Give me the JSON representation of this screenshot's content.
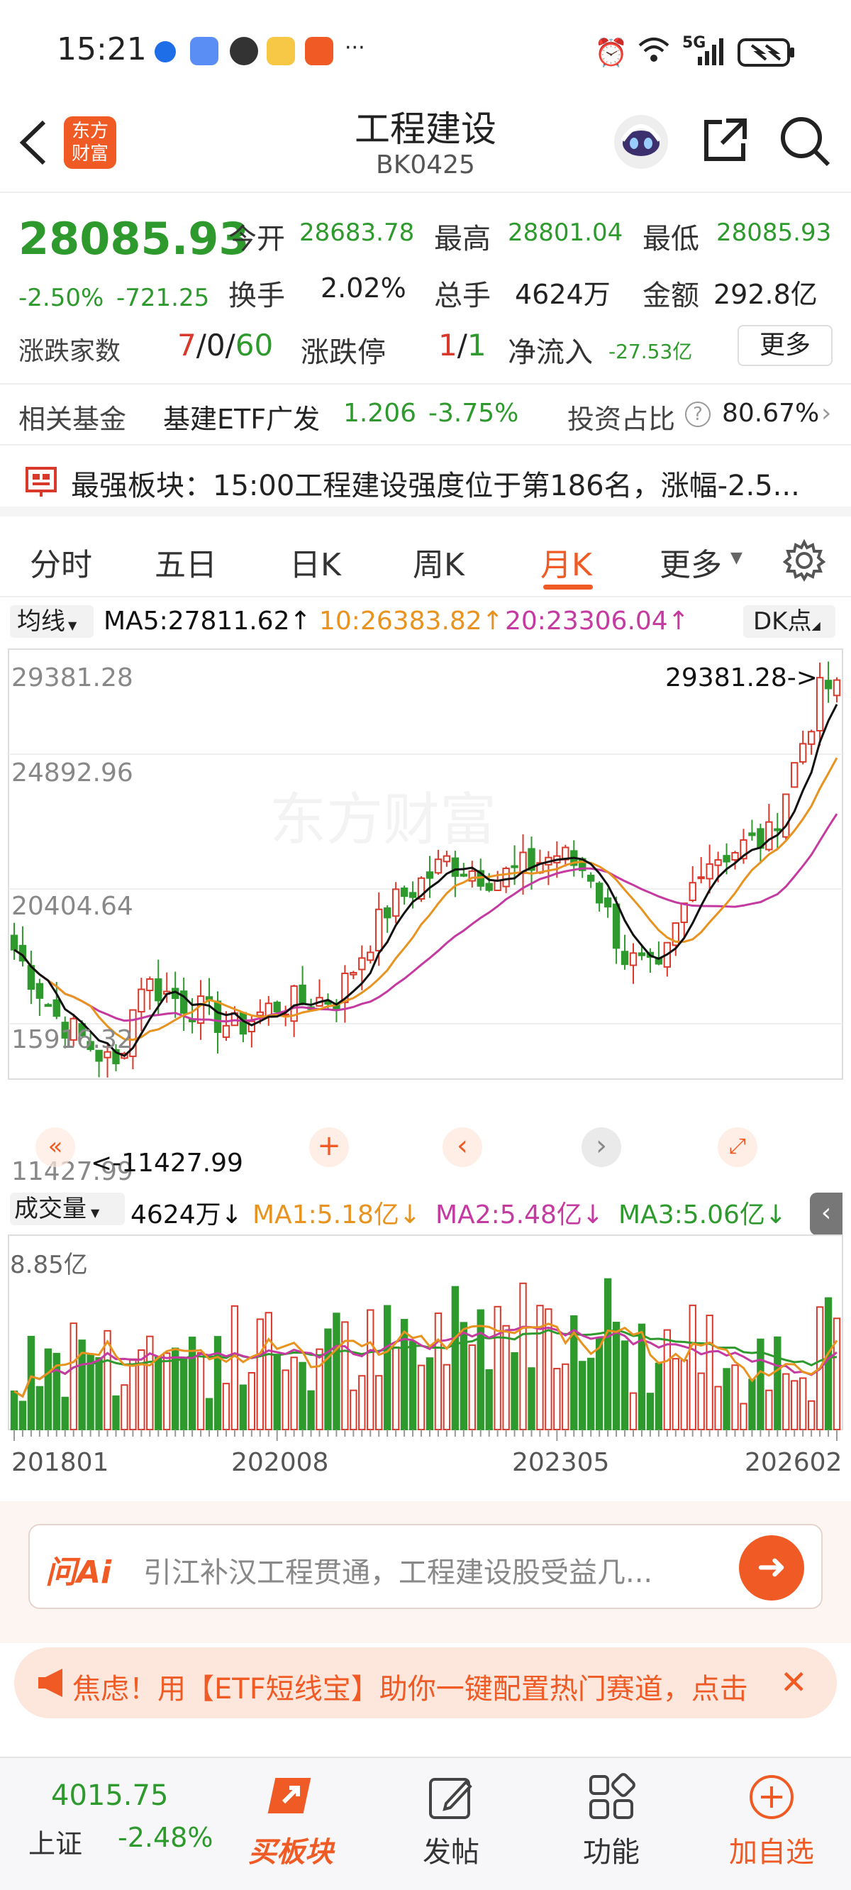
{
  "status_bar": {
    "time": "15:21",
    "ellipsis": "···",
    "network": "5G"
  },
  "header": {
    "title": "工程建设",
    "code": "BK0425",
    "logo_line1": "东方",
    "logo_line2": "财富"
  },
  "quote": {
    "price": "28085.93",
    "change_pct": "-2.50%",
    "change_abs": "-721.25",
    "open_label": "今开",
    "open": "28683.78",
    "high_label": "最高",
    "high": "28801.04",
    "low_label": "最低",
    "low": "28085.93",
    "turnover_label": "换手",
    "turnover": "2.02%",
    "volume_label": "总手",
    "volume": "4624万",
    "amount_label": "金额",
    "amount": "292.8亿",
    "breadth_label": "涨跌家数",
    "breadth_up": "7",
    "breadth_flat": "0",
    "breadth_down": "60",
    "limit_label": "涨跌停",
    "limit_up": "1",
    "limit_down": "1",
    "netflow_label": "净流入",
    "netflow": "-27.53亿",
    "more_label": "更多"
  },
  "fund": {
    "label": "相关基金",
    "name": "基建ETF广发",
    "price": "1.206",
    "pct": "-3.75%",
    "ratio_label": "投资占比",
    "ratio": "80.67%"
  },
  "strongest": {
    "text": "最强板块：15:00工程建设强度位于第186名，涨幅-2.5..."
  },
  "tabs": [
    {
      "label": "分时"
    },
    {
      "label": "五日"
    },
    {
      "label": "日K"
    },
    {
      "label": "周K"
    },
    {
      "label": "月K"
    },
    {
      "label": "更多"
    }
  ],
  "chart_header": {
    "ma_selector": "均线",
    "ma5": "MA5:27811.62↑",
    "ma10": "10:26383.82↑",
    "ma20": "20:23306.04↑",
    "dk_button": "DK点"
  },
  "price_axis": {
    "max_label": "29381.28",
    "l2": "24892.96",
    "l3": "20404.64",
    "l4": "15916.32",
    "min_label": "11427.99",
    "max_annot": "29381.28->",
    "min_annot": "<-11427.99"
  },
  "volume_header": {
    "selector": "成交量",
    "vol": "4624万↓",
    "ma1": "MA1:5.18亿↓",
    "ma2": "MA2:5.48亿↓",
    "ma3": "MA3:5.06亿↓",
    "max_label": "8.85亿"
  },
  "date_axis": {
    "d1": "201801",
    "d2": "202008",
    "d3": "202305",
    "d4": "202602"
  },
  "ai_box": {
    "brand": "问Ai",
    "text": "引江补汉工程贯通，工程建设股受益几..."
  },
  "banner": {
    "text": "焦虑！用【ETF短线宝】助你一键配置热门赛道，点击"
  },
  "bottom_nav": {
    "index_value": "4015.75",
    "index_name": "上证",
    "index_pct": "-2.48%",
    "buy_label": "买板块",
    "post_label": "发帖",
    "func_label": "功能",
    "add_label": "加自选"
  },
  "colors": {
    "up": "#d9392b",
    "down": "#2e9a2e",
    "ma5": "#111111",
    "ma10": "#e89320",
    "ma20": "#c43aa0",
    "accent": "#f05a24"
  },
  "chart_data": {
    "type": "candlestick",
    "period": "monthly",
    "y_range": [
      11427.99,
      29381.28
    ],
    "series_trend": [
      {
        "date": "2018-01",
        "close": 16800
      },
      {
        "date": "2018-06",
        "close": 14000
      },
      {
        "date": "2019-01",
        "close": 11800
      },
      {
        "date": "2019-04",
        "close": 15500
      },
      {
        "date": "2020-03",
        "close": 13500
      },
      {
        "date": "2020-08",
        "close": 14500
      },
      {
        "date": "2021-03",
        "close": 14800
      },
      {
        "date": "2021-09",
        "close": 18500
      },
      {
        "date": "2022-04",
        "close": 20500
      },
      {
        "date": "2022-10",
        "close": 19800
      },
      {
        "date": "2023-05",
        "close": 20800
      },
      {
        "date": "2023-09",
        "close": 20000
      },
      {
        "date": "2024-01",
        "close": 16500
      },
      {
        "date": "2024-05",
        "close": 15600
      },
      {
        "date": "2024-10",
        "close": 20500
      },
      {
        "date": "2025-06",
        "close": 21500
      },
      {
        "date": "2025-12",
        "close": 27500
      },
      {
        "date": "2026-02",
        "close": 28085.93
      }
    ]
  }
}
